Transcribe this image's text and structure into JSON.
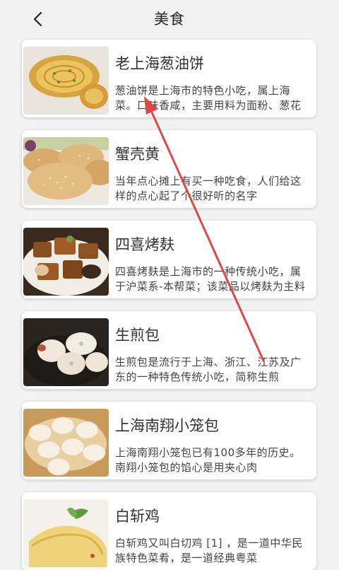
{
  "header": {
    "title": "美食",
    "back_icon": "chevron-left-icon"
  },
  "foods": [
    {
      "name": "老上海葱油饼",
      "desc": "葱油饼是上海市的特色小吃，属上海菜。口味香咸，主要用料为面粉、葱花"
    },
    {
      "name": "蟹壳黄",
      "desc": "当年点心摊上有买一种吃食，人们给这样的点心起了个很好听的名字"
    },
    {
      "name": "四喜烤麸",
      "desc": "四喜烤麸是上海市的一种传统小吃，属于沪菜系-本帮菜；该菜品以烤麸为主料"
    },
    {
      "name": "生煎包",
      "desc": "生煎包是流行于上海、浙江、江苏及广东的一种特色传统小吃，简称生煎"
    },
    {
      "name": "上海南翔小笼包",
      "desc": "上海南翔小笼包已有100多年的历史。南翔小笼包的馅心是用夹心肉"
    },
    {
      "name": "白斩鸡",
      "desc": "白斩鸡又叫白切鸡 [1] ，是一道中华民族特色菜肴，是一道经典粤菜"
    }
  ],
  "colors": {
    "background": "#f2f2f2",
    "card": "#ffffff",
    "annotation_arrow": "#e04848"
  }
}
